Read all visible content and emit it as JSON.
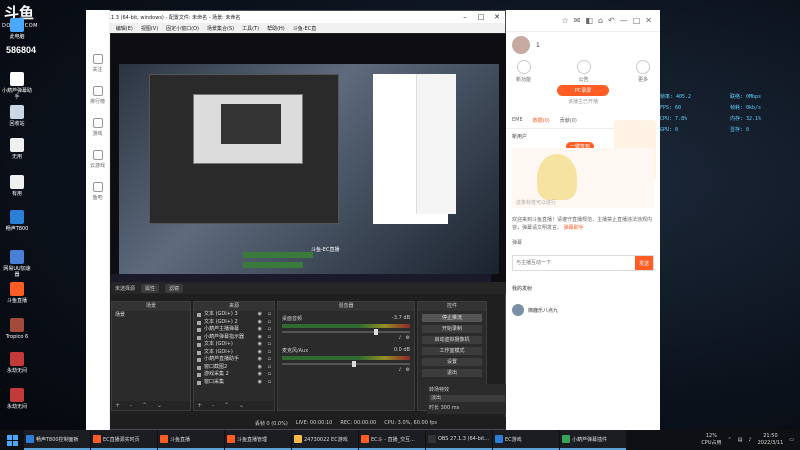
{
  "desktop": {
    "logo": "斗鱼",
    "site": "DOUYU.COM",
    "room_id": "586804",
    "icons": [
      {
        "label": "此电脑",
        "color": "#4aa8ff"
      },
      {
        "label": "小葫芦弹幕助手",
        "color": "#ffffff"
      },
      {
        "label": "回收站",
        "color": "#c9d7e6"
      },
      {
        "label": "无用",
        "color": "#f0f0f0"
      },
      {
        "label": "有用",
        "color": "#f0f0f0"
      },
      {
        "label": "畅声T800",
        "color": "#2b7fd6"
      },
      {
        "label": "网易UU加速器",
        "color": "#4a7fd6"
      },
      {
        "label": "斗鱼直播",
        "color": "#ff5d23"
      },
      {
        "label": "Tropico 6",
        "color": "#a34a3a"
      },
      {
        "label": "永劫无间",
        "color": "#c23a3a"
      },
      {
        "label": "永劫无间",
        "color": "#c23a3a"
      }
    ]
  },
  "obs": {
    "title": "OBS 27.1.3 (64-bit, windows) - 配置文件: 未命名 - 场景: 未命名",
    "menu": [
      "文件(F)",
      "编辑(E)",
      "视图(V)",
      "固定小窗口(O)",
      "场景集合(S)",
      "工具(T)",
      "帮助(H)",
      "斗鱼-EC直"
    ],
    "preview_overlay_label": "斗鱼-EC直播",
    "toolbar": {
      "label": "未选择源",
      "props": "属性",
      "filters": "滤镜"
    },
    "scenes": {
      "header": "场景",
      "items": [
        "场景"
      ]
    },
    "sources": {
      "header": "来源",
      "items": [
        "文本 (GDI+) 3",
        "文本 (GDI+) 2",
        "小葫芦主播弹幕",
        "小葫芦弹幕指示器",
        "文本 (GDI+)",
        "文本 (GDI+)",
        "小葫芦直播助手",
        "窗口截图2",
        "游戏采集 2",
        "窗口采集"
      ]
    },
    "mixer": {
      "header": "混音器",
      "channels": [
        {
          "name": "桌面音频",
          "db": "-3.7 dB",
          "level": 0.72
        },
        {
          "name": "麦克风/Aux",
          "db": "0.0 dB",
          "level": 0.55
        }
      ]
    },
    "controls": {
      "header": "控件",
      "buttons": [
        "停止推流",
        "开始录制",
        "启动虚拟摄像机",
        "工作室模式",
        "设置",
        "退出"
      ]
    },
    "transitions": {
      "header": "转场特效",
      "selected": "淡出",
      "duration_label": "时长",
      "duration": "300 ms"
    },
    "footer_glyphs": "+ - ⌃ ⌄",
    "status": {
      "dropped": "丢帧 0 (0.0%)",
      "live": "LIVE: 00:00:10",
      "rec": "REC: 00:00:00",
      "cpu": "CPU: 3.0%, 60.00 fps"
    }
  },
  "douyu": {
    "side": [
      "关注",
      "排行榜",
      "游戏",
      "云游戏",
      "鱼吧"
    ],
    "top_controls": [
      "☆",
      "✉",
      "◧",
      "⌂",
      "↶",
      "—",
      "□",
      "✕"
    ],
    "user_level": "1",
    "tools": [
      "新功能",
      "公告",
      "更多"
    ],
    "pc_button": "PC录屏",
    "pc_sub": "该播主已开播",
    "tabs": [
      "EME",
      "数据(0)",
      "贡献(0)"
    ],
    "anchor_label": "新用户",
    "tag_button": "一键签到",
    "mascot_caption": "这条标签可以进行",
    "notice": "欢迎来到斗鱼直播！请遵守直播规范，主播禁止直播违法违规内容，弹幕请文明发言。",
    "notice_highlight": "弹幕助手",
    "input_placeholder": "与主播互动一下",
    "send": "发送",
    "gift_label": "弹幕",
    "my_gifts": "我的发射",
    "user_name": "御鹿乐八点九"
  },
  "stats": {
    "rows": [
      [
        "帧率: 405.2",
        "联络: 0Mbps"
      ],
      [
        "FPS: 60",
        "帧耗: 0kb/s"
      ],
      [
        "CPU: 7.8%",
        "内存: 32.1%"
      ],
      [
        "GPU: 0",
        "显存: 0"
      ]
    ]
  },
  "taskbar": {
    "tasks": [
      {
        "label": "畅声T800控制面板",
        "color": "#2b7fd6"
      },
      {
        "label": "EC直播源实时页",
        "color": "#ff5d23"
      },
      {
        "label": "斗鱼直播",
        "color": "#ff5d23"
      },
      {
        "label": "斗鱼直播管理",
        "color": "#ff5d23"
      },
      {
        "label": "24730022 EC游戏",
        "color": "#f5b94a"
      },
      {
        "label": "EC斗 - 直播_交互...",
        "color": "#ff5d23"
      },
      {
        "label": "OBS 27.1.3 (64-bit...",
        "color": "#333333"
      },
      {
        "label": "EC游戏",
        "color": "#2b7fd6"
      },
      {
        "label": "小葫芦弹幕插件",
        "color": "#3aa35a"
      }
    ],
    "cpu_pct": "12%",
    "cpu_label": "CPU占用",
    "time": "21:50",
    "date": "2022/3/11"
  }
}
